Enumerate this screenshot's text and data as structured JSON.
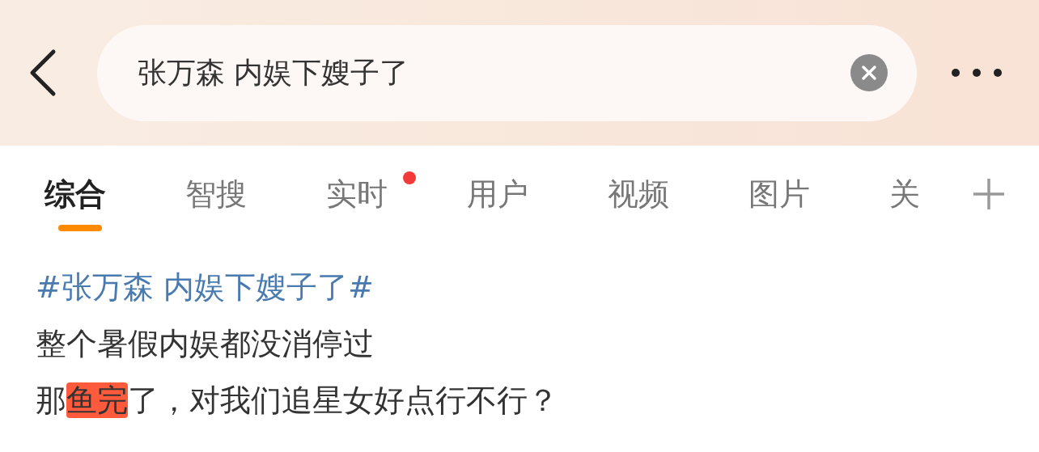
{
  "search": {
    "value": "张万森 内娱下嫂子了"
  },
  "tabs": [
    {
      "label": "综合",
      "selected": true,
      "dot": false
    },
    {
      "label": "智搜",
      "selected": false,
      "dot": false
    },
    {
      "label": "实时",
      "selected": false,
      "dot": true
    },
    {
      "label": "用户",
      "selected": false,
      "dot": false
    },
    {
      "label": "视频",
      "selected": false,
      "dot": false
    },
    {
      "label": "图片",
      "selected": false,
      "dot": false
    },
    {
      "label": "关",
      "selected": false,
      "dot": false
    }
  ],
  "post": {
    "hashtag": "#张万森 内娱下嫂子了#",
    "lines": [
      [
        {
          "text": "整个暑假内娱都没消停过",
          "highlight": false
        }
      ],
      [
        {
          "text": "那",
          "highlight": false
        },
        {
          "text": "鱼完",
          "highlight": true
        },
        {
          "text": "了，对我们追星女好点行不行？",
          "highlight": false
        }
      ]
    ]
  }
}
